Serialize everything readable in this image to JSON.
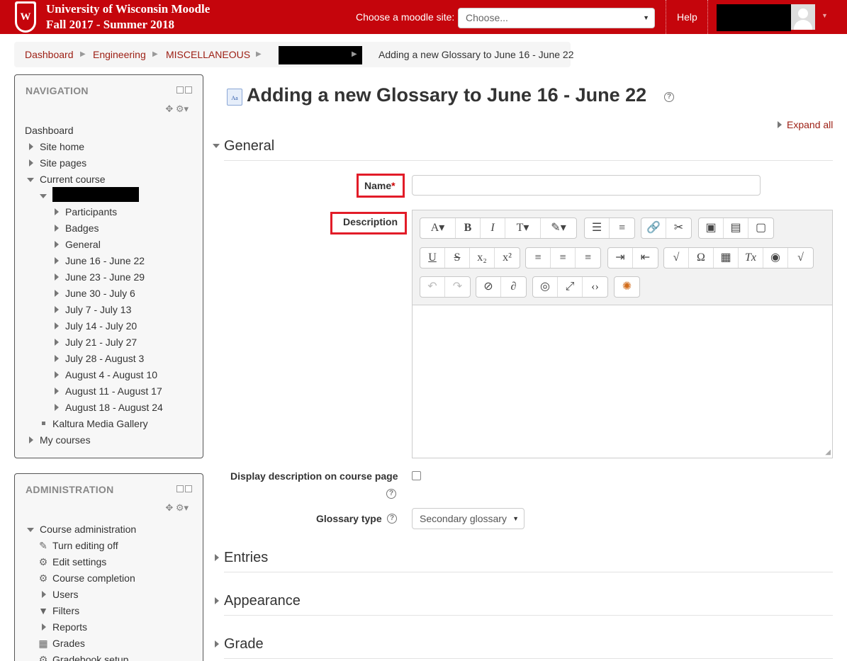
{
  "header": {
    "crest_letter": "W",
    "title_line1": "University of Wisconsin Moodle",
    "title_line2": "Fall 2017 - Summer 2018",
    "choose_label": "Choose a moodle site:",
    "choose_value": "Choose...",
    "help_label": "Help",
    "brand_color": "#c5050c"
  },
  "breadcrumb": {
    "items": [
      "Dashboard",
      "Engineering",
      "MISCELLANEOUS"
    ],
    "current": "Adding a new Glossary to June 16 - June 22",
    "link_color": "#9c1d12"
  },
  "navigation": {
    "title": "NAVIGATION",
    "dashboard": "Dashboard",
    "site_home": "Site home",
    "site_pages": "Site pages",
    "current_course": "Current course",
    "course_items": [
      "Participants",
      "Badges",
      "General",
      "June 16 - June 22",
      "June 23 - June 29",
      "June 30 - July 6",
      "July 7 - July 13",
      "July 14 - July 20",
      "July 21 - July 27",
      "July 28 - August 3",
      "August 4 - August 10",
      "August 11 - August 17",
      "August 18 - August 24"
    ],
    "kaltura": "Kaltura Media Gallery",
    "my_courses": "My courses"
  },
  "administration": {
    "title": "ADMINISTRATION",
    "course_admin": "Course administration",
    "items": [
      {
        "label": "Turn editing off",
        "icon": "pencil-icon"
      },
      {
        "label": "Edit settings",
        "icon": "gear-icon"
      },
      {
        "label": "Course completion",
        "icon": "gear-icon"
      },
      {
        "label": "Users",
        "icon": "expand-arrow-icon"
      },
      {
        "label": "Filters",
        "icon": "filter-icon"
      },
      {
        "label": "Reports",
        "icon": "expand-arrow-icon"
      },
      {
        "label": "Grades",
        "icon": "table-icon"
      },
      {
        "label": "Gradebook setup",
        "icon": "gear-icon"
      }
    ]
  },
  "main": {
    "page_title": "Adding a new Glossary to June 16 - June 22",
    "expand_all": "Expand all",
    "sections": [
      "General",
      "Entries",
      "Appearance",
      "Grade"
    ],
    "name_label": "Name",
    "required_mark": "*",
    "description_label": "Description",
    "display_desc_label": "Display description on course page",
    "glossary_type_label": "Glossary type",
    "glossary_type_value": "Secondary glossary"
  }
}
